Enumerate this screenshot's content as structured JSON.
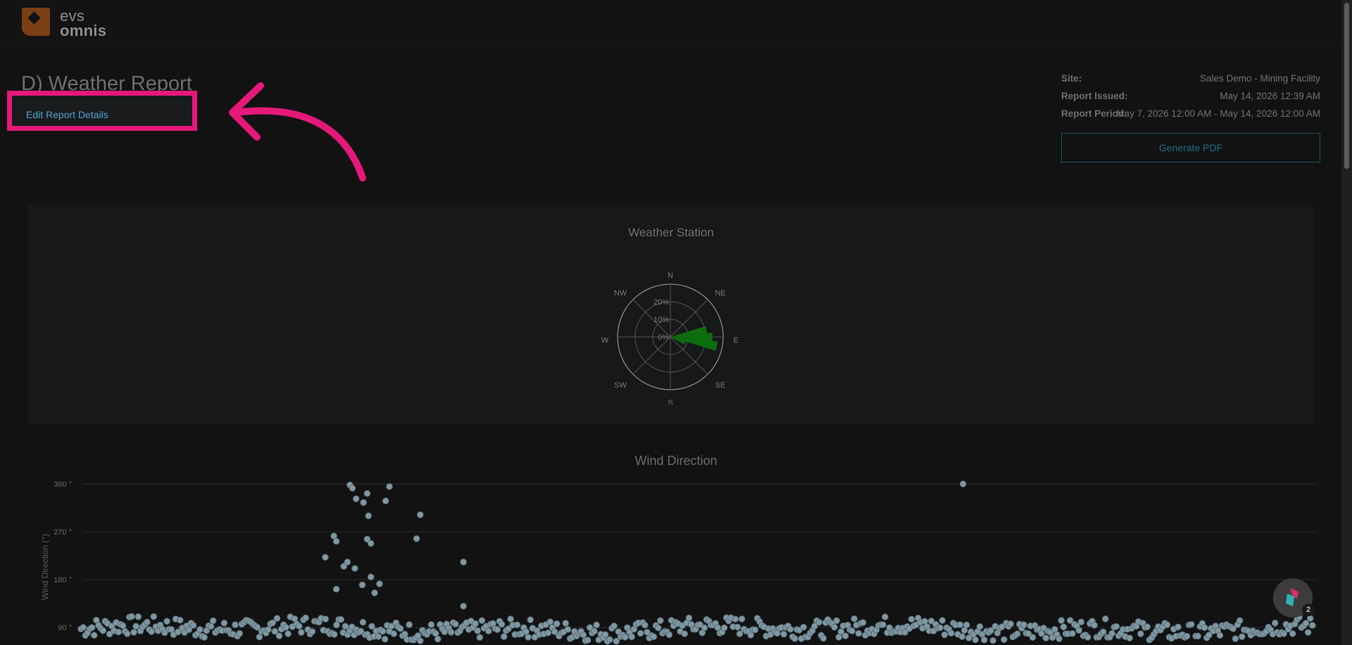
{
  "brand": {
    "line1": "evs",
    "line2": "omnis"
  },
  "page": {
    "title": "D) Weather Report",
    "edit_link": "Edit Report Details"
  },
  "meta": {
    "site_label": "Site:",
    "site_value": "Sales Demo - Mining Facility",
    "issued_label": "Report Issued:",
    "issued_value": "May 14, 2026 12:39 AM",
    "period_label": "Report Period:",
    "period_value": "May 7, 2026 12:00 AM - May 14, 2026 12:00 AM",
    "generate_pdf": "Generate PDF"
  },
  "colors": {
    "accent_pink": "#e5197a",
    "link": "#4ea5d0",
    "brand": "#7a3f14",
    "rose_fill": "#0d6e0d",
    "point": "#7f98a3"
  },
  "weather_station": {
    "title": "Weather Station",
    "directions": [
      "N",
      "NE",
      "E",
      "SE",
      "S",
      "SW",
      "W",
      "NW"
    ],
    "radial_ticks": [
      "0%",
      "10%",
      "20%"
    ]
  },
  "badge_count": "2",
  "chart_data": [
    {
      "type": "polar-bar",
      "title": "Weather Station",
      "directions": [
        "N",
        "NE",
        "E",
        "SE",
        "S",
        "SW",
        "W",
        "NW"
      ],
      "radial_ticks": [
        "0%",
        "10%",
        "20%"
      ],
      "series": [
        {
          "values_by_angle": [
            {
              "angle": 78.75,
              "value": 21
            },
            {
              "angle": 90,
              "value": 24
            },
            {
              "angle": 101.25,
              "value": 27
            },
            {
              "angle": 112.5,
              "value": 9
            }
          ]
        }
      ]
    },
    {
      "type": "scatter",
      "title": "Wind Direction",
      "ylabel": "Wind Direction (°)",
      "ylim": [
        0,
        360
      ],
      "yticks": [
        "90 °",
        "180 °",
        "270 °",
        "360 °"
      ],
      "x": [],
      "note_y_low_band": [
        70,
        105
      ],
      "outliers": [
        {
          "x": 0.218,
          "y": 358
        },
        {
          "x": 0.22,
          "y": 352
        },
        {
          "x": 0.223,
          "y": 332
        },
        {
          "x": 0.229,
          "y": 325
        },
        {
          "x": 0.232,
          "y": 342
        },
        {
          "x": 0.233,
          "y": 300
        },
        {
          "x": 0.247,
          "y": 328
        },
        {
          "x": 0.25,
          "y": 355
        },
        {
          "x": 0.275,
          "y": 302
        },
        {
          "x": 0.272,
          "y": 257
        },
        {
          "x": 0.205,
          "y": 262
        },
        {
          "x": 0.207,
          "y": 252
        },
        {
          "x": 0.198,
          "y": 222
        },
        {
          "x": 0.213,
          "y": 205
        },
        {
          "x": 0.216,
          "y": 213
        },
        {
          "x": 0.232,
          "y": 256
        },
        {
          "x": 0.235,
          "y": 248
        },
        {
          "x": 0.228,
          "y": 170
        },
        {
          "x": 0.235,
          "y": 185
        },
        {
          "x": 0.242,
          "y": 172
        },
        {
          "x": 0.238,
          "y": 155
        },
        {
          "x": 0.222,
          "y": 201
        },
        {
          "x": 0.207,
          "y": 162
        },
        {
          "x": 0.31,
          "y": 213
        },
        {
          "x": 0.31,
          "y": 130
        },
        {
          "x": 0.715,
          "y": 360
        }
      ]
    }
  ]
}
